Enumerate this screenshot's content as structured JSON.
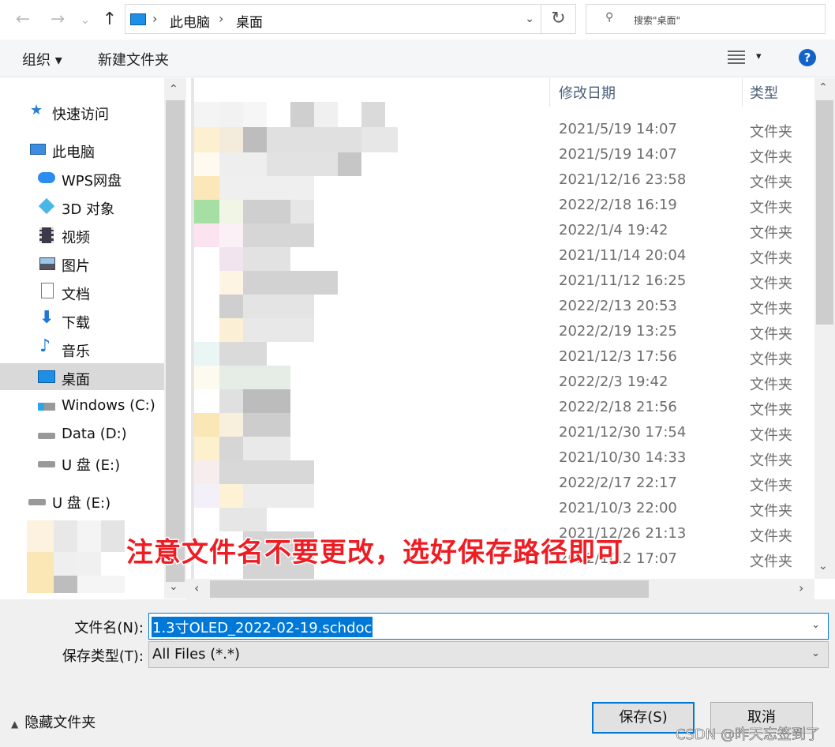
{
  "nav": {
    "back": "←",
    "forward": "→",
    "recent": "⌄",
    "up": "↑",
    "refresh": "↻"
  },
  "address": {
    "crumbs": [
      "此电脑",
      "桌面"
    ],
    "dropdown": "⌄"
  },
  "search": {
    "placeholder": "搜索\"桌面\""
  },
  "toolbar": {
    "organize": "组织 ▾",
    "new_folder": "新建文件夹",
    "view_dd": "▾",
    "help": "?"
  },
  "sidebar": {
    "items": [
      {
        "label": "快速访问",
        "icon": "star-icon",
        "color": "#2a7fd4"
      },
      {
        "label": "此电脑",
        "icon": "computer-icon",
        "color": "#3c8de0"
      },
      {
        "label": "WPS网盘",
        "icon": "cloud-icon",
        "color": "#2d8cf0"
      },
      {
        "label": "3D 对象",
        "icon": "cube-icon",
        "color": "#49b6e8"
      },
      {
        "label": "视频",
        "icon": "film-icon",
        "color": "#445"
      },
      {
        "label": "图片",
        "icon": "picture-icon",
        "color": "#556"
      },
      {
        "label": "文档",
        "icon": "document-icon",
        "color": "#778"
      },
      {
        "label": "下载",
        "icon": "download-icon",
        "color": "#1e78d6"
      },
      {
        "label": "音乐",
        "icon": "music-icon",
        "color": "#1e78d6"
      },
      {
        "label": "桌面",
        "icon": "desktop-icon",
        "color": "#1e8fe6"
      },
      {
        "label": "Windows (C:)",
        "icon": "drive-c-icon",
        "color": "#2aa7e8"
      },
      {
        "label": "Data (D:)",
        "icon": "drive-icon",
        "color": "#777"
      },
      {
        "label": "U 盘 (E:)",
        "icon": "usb-drive-icon",
        "color": "#777"
      },
      {
        "label": "U 盘 (E:)",
        "icon": "usb-drive-icon",
        "color": "#777"
      }
    ]
  },
  "columns": {
    "modified": "修改日期",
    "type": "类型"
  },
  "files": [
    {
      "date": "2021/5/19 14:07",
      "type": "文件夹"
    },
    {
      "date": "2021/5/19 14:07",
      "type": "文件夹"
    },
    {
      "date": "2021/12/16 23:58",
      "type": "文件夹"
    },
    {
      "date": "2022/2/18 16:19",
      "type": "文件夹"
    },
    {
      "date": "2022/1/4 19:42",
      "type": "文件夹"
    },
    {
      "date": "2021/11/14 20:04",
      "type": "文件夹"
    },
    {
      "date": "2021/11/12 16:25",
      "type": "文件夹"
    },
    {
      "date": "2022/2/13 20:53",
      "type": "文件夹"
    },
    {
      "date": "2022/2/19 13:25",
      "type": "文件夹"
    },
    {
      "date": "2021/12/3 17:56",
      "type": "文件夹"
    },
    {
      "date": "2022/2/3 19:42",
      "type": "文件夹"
    },
    {
      "date": "2022/2/18 21:56",
      "type": "文件夹"
    },
    {
      "date": "2021/12/30 17:54",
      "type": "文件夹"
    },
    {
      "date": "2021/10/30 14:33",
      "type": "文件夹"
    },
    {
      "date": "2022/2/17 22:17",
      "type": "文件夹"
    },
    {
      "date": "2021/10/3 22:00",
      "type": "文件夹"
    },
    {
      "date": "2021/12/26 21:13",
      "type": "文件夹"
    },
    {
      "date": "2022/1/12 17:07",
      "type": "文件夹"
    }
  ],
  "overlay_note": "注意文件名不要更改，选好保存路径即可",
  "form": {
    "filename_label": "文件名(N):",
    "filename_value": "1.3寸OLED_2022-02-19.schdoc",
    "filetype_label": "保存类型(T):",
    "filetype_value": "All Files (*.*)"
  },
  "footer": {
    "hide_folders": "隐藏文件夹",
    "hide_arrow": "▲",
    "save": "保存(S)",
    "cancel": "取消"
  },
  "watermark": "CSDN @昨天忘签到了",
  "scroll": {
    "up": "⌃",
    "down": "⌄",
    "left": "‹",
    "right": "›"
  }
}
